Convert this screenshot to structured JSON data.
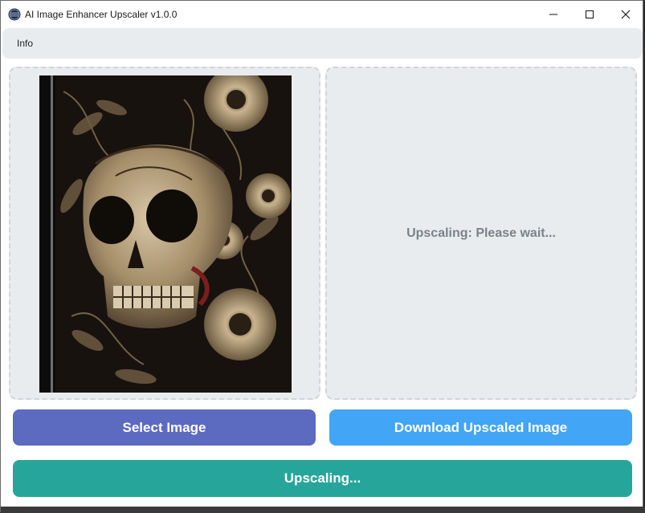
{
  "window": {
    "title": "AI Image Enhancer Upscaler v1.0.0",
    "icon": "app-globe-icon",
    "controls": [
      "minimize-icon",
      "maximize-icon",
      "close-icon"
    ]
  },
  "menu": {
    "items": [
      {
        "label": "Info"
      }
    ]
  },
  "panels": {
    "left": {
      "content": "skull artwork image",
      "icon": "image-preview"
    },
    "right": {
      "status_text": "Upscaling: Please wait..."
    }
  },
  "buttons": {
    "select": {
      "label": "Select Image",
      "color": "#5c6bc0"
    },
    "download": {
      "label": "Download Upscaled Image",
      "color": "#42a5f5"
    },
    "upscale": {
      "label": "Upscaling...",
      "color": "#26a69a"
    }
  },
  "colors": {
    "panel_bg": "#e9ecef",
    "panel_border": "#cfd5db",
    "status_text": "#7b8288"
  }
}
